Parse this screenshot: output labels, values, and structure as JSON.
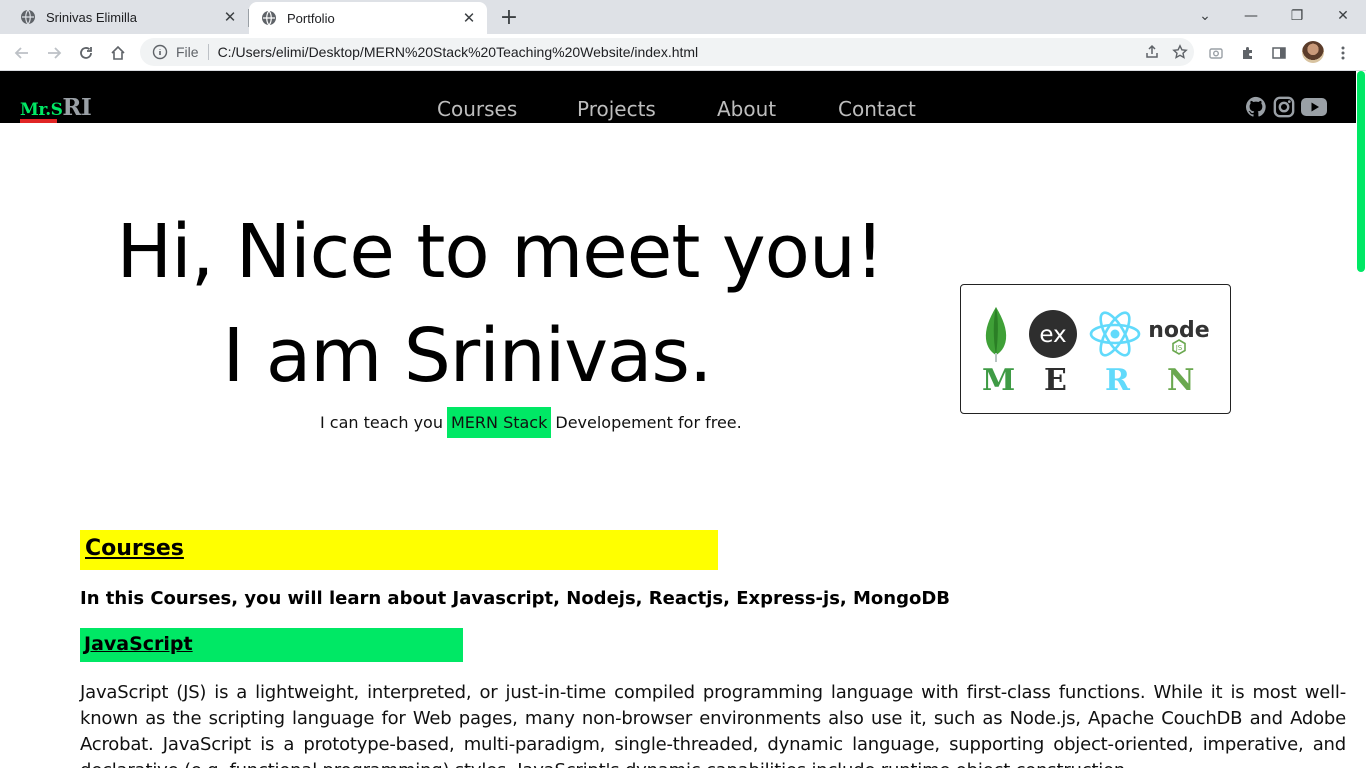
{
  "browser": {
    "tabs": [
      {
        "title": "Srinivas Elimilla",
        "active": false
      },
      {
        "title": "Portfolio",
        "active": true
      }
    ],
    "omnibox": {
      "scheme_label": "File",
      "url": "C:/Users/elimi/Desktop/MERN%20Stack%20Teaching%20Website/index.html"
    }
  },
  "site": {
    "logo": {
      "part1": "Mr.S",
      "part2": "RI"
    },
    "nav": [
      "Courses",
      "Projects",
      "About",
      "Contact"
    ],
    "social_icons": [
      "github-icon",
      "instagram-icon",
      "youtube-icon"
    ],
    "hero": {
      "line1": "Hi, Nice to meet you!",
      "line2": "I am Srinivas.",
      "sub_before": "I can teach you",
      "sub_highlight": "MERN Stack",
      "sub_after": "Developement for free."
    },
    "mern": {
      "letters": [
        "M",
        "E",
        "R",
        "N"
      ],
      "letter_colors": [
        "#3f9b45",
        "#2e2e2e",
        "#61dafb",
        "#6aa84f"
      ],
      "logo_icons": [
        "mongodb-icon",
        "express-icon",
        "react-icon",
        "nodejs-icon"
      ],
      "express_abbr": "ex",
      "node_wordmark": "node",
      "node_badge": "JS"
    },
    "courses": {
      "title": "Courses",
      "description": "In this Courses, you will learn about Javascript, Nodejs, Reactjs, Express-js, MongoDB",
      "javascript": {
        "title": "JavaScript",
        "text": "JavaScript (JS) is a lightweight, interpreted, or just-in-time compiled programming language with first-class functions. While it is most well-known as the scripting language for Web pages, many non-browser environments also use it, such as Node.js, Apache CouchDB and Adobe Acrobat. JavaScript is a prototype-based, multi-paradigm, single-threaded, dynamic language, supporting object-oriented, imperative, and declarative (e.g. functional programming) styles. JavaScript's dynamic capabilities include runtime object construction."
      }
    }
  },
  "colors": {
    "accent_green": "#00e865",
    "highlight_yellow": "#ffff00",
    "nav_bg": "#000000",
    "logo_red": "#e02424"
  }
}
